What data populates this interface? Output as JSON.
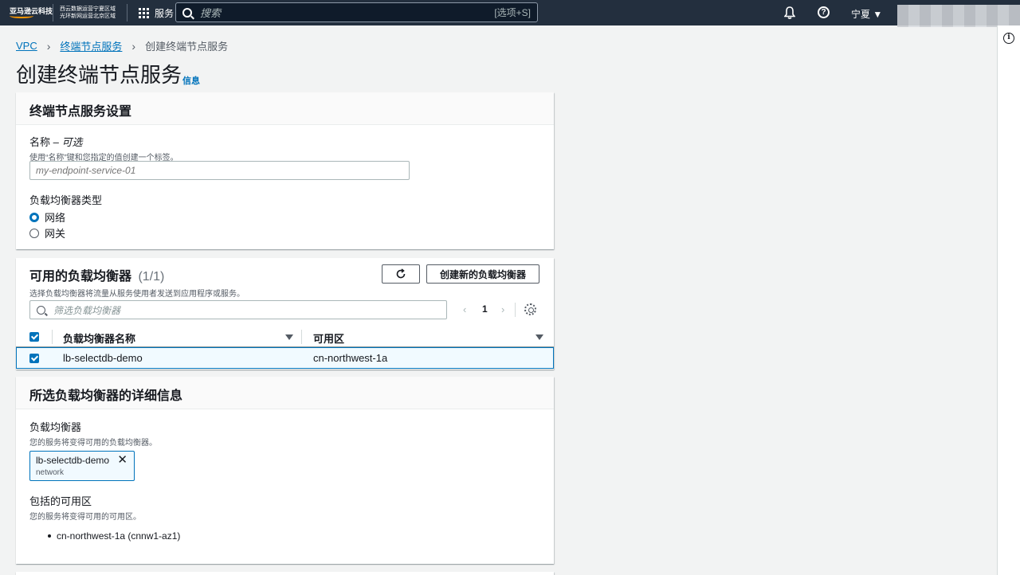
{
  "nav": {
    "logo_text": "亚马逊云科技",
    "region_line1": "西云数据运营宁夏区域",
    "region_line2": "光环新网运营北京区域",
    "services_label": "服务",
    "search_placeholder": "搜索",
    "search_shortcut": "[选项+S]",
    "region_selector": "宁夏 ▼"
  },
  "breadcrumb": {
    "root": "VPC",
    "parent": "终端节点服务",
    "current": "创建终端节点服务"
  },
  "page": {
    "title": "创建终端节点服务",
    "info_link": "信息"
  },
  "settings": {
    "header": "终端节点服务设置",
    "name_label": "名称 – ",
    "name_optional": "可选",
    "name_desc": "使用“名称”键和您指定的值创建一个标签。",
    "name_placeholder": "my-endpoint-service-01",
    "lb_type_label": "负载均衡器类型",
    "lb_type_options": [
      "网络",
      "网关"
    ],
    "lb_type_selected": "网络"
  },
  "available_lbs": {
    "header": "可用的负载均衡器",
    "count": "(1/1)",
    "desc": "选择负载均衡器将流量从服务使用者发送到应用程序或服务。",
    "create_button": "创建新的负载均衡器",
    "filter_placeholder": "筛选负载均衡器",
    "page_prev": "‹",
    "page_number": "1",
    "page_next": "›",
    "columns": [
      "负载均衡器名称",
      "可用区"
    ],
    "rows": [
      {
        "name": "lb-selectdb-demo",
        "az": "cn-northwest-1a",
        "selected": true
      }
    ]
  },
  "selected_details": {
    "header": "所选负载均衡器的详细信息",
    "lb_label": "负载均衡器",
    "lb_desc": "您的服务将变得可用的负载均衡器。",
    "token_name": "lb-selectdb-demo",
    "token_type": "network",
    "token_remove": "✕",
    "az_label": "包括的可用区",
    "az_desc": "您的服务将变得可用的可用区。",
    "az_items": [
      "cn-northwest-1a (cnnw1-az1)"
    ]
  },
  "rail": {
    "info_glyph": "i"
  },
  "colors": {
    "nav_bg": "#232f3e",
    "link": "#0073bb",
    "accent": "#ff9900"
  }
}
